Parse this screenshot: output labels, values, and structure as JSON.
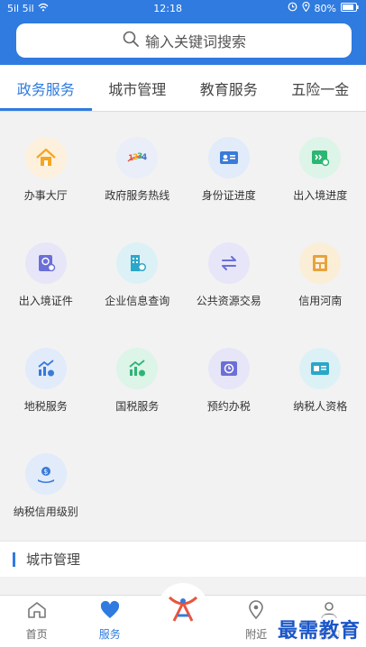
{
  "status_bar": {
    "signal_left": "5il 5il",
    "time": "12:18",
    "battery": "80%"
  },
  "search": {
    "placeholder": "输入关键词搜索"
  },
  "tabs": [
    {
      "label": "政务服务",
      "active": true
    },
    {
      "label": "城市管理",
      "active": false
    },
    {
      "label": "教育服务",
      "active": false
    },
    {
      "label": "五险一金",
      "active": false
    }
  ],
  "services": [
    {
      "label": "办事大厅",
      "icon": "house-icon",
      "color": "#f5a623"
    },
    {
      "label": "政府服务热线",
      "icon": "hotline-12345-icon",
      "color": "#e8553d"
    },
    {
      "label": "身份证进度",
      "icon": "id-card-icon",
      "color": "#3a7ad9"
    },
    {
      "label": "出入境进度",
      "icon": "border-progress-icon",
      "color": "#2bb673"
    },
    {
      "label": "出入境证件",
      "icon": "passport-icon",
      "color": "#6b6fd8"
    },
    {
      "label": "企业信息查询",
      "icon": "building-icon",
      "color": "#2aa7c9"
    },
    {
      "label": "公共资源交易",
      "icon": "exchange-icon",
      "color": "#6b6fd8"
    },
    {
      "label": "信用河南",
      "icon": "credit-icon",
      "color": "#e9a23b"
    },
    {
      "label": "地税服务",
      "icon": "local-tax-icon",
      "color": "#3a7ad9"
    },
    {
      "label": "国税服务",
      "icon": "national-tax-icon",
      "color": "#2bb673"
    },
    {
      "label": "预约办税",
      "icon": "appointment-icon",
      "color": "#6b6fd8"
    },
    {
      "label": "纳税人资格",
      "icon": "taxpayer-icon",
      "color": "#2aa7c9"
    },
    {
      "label": "纳税信用级别",
      "icon": "tax-credit-icon",
      "color": "#3a7ad9"
    }
  ],
  "section": {
    "title": "城市管理"
  },
  "bottom_nav": [
    {
      "label": "首页",
      "icon": "home-icon",
      "active": false
    },
    {
      "label": "服务",
      "icon": "heart-icon",
      "active": true
    },
    {
      "label": "",
      "icon": "app-logo-icon",
      "active": false
    },
    {
      "label": "附近",
      "icon": "location-icon",
      "active": false
    },
    {
      "label": "我的",
      "icon": "user-icon",
      "active": false
    }
  ],
  "watermark": "最需教育",
  "colors": {
    "primary": "#2f7be0",
    "background": "#f2f2f2"
  }
}
